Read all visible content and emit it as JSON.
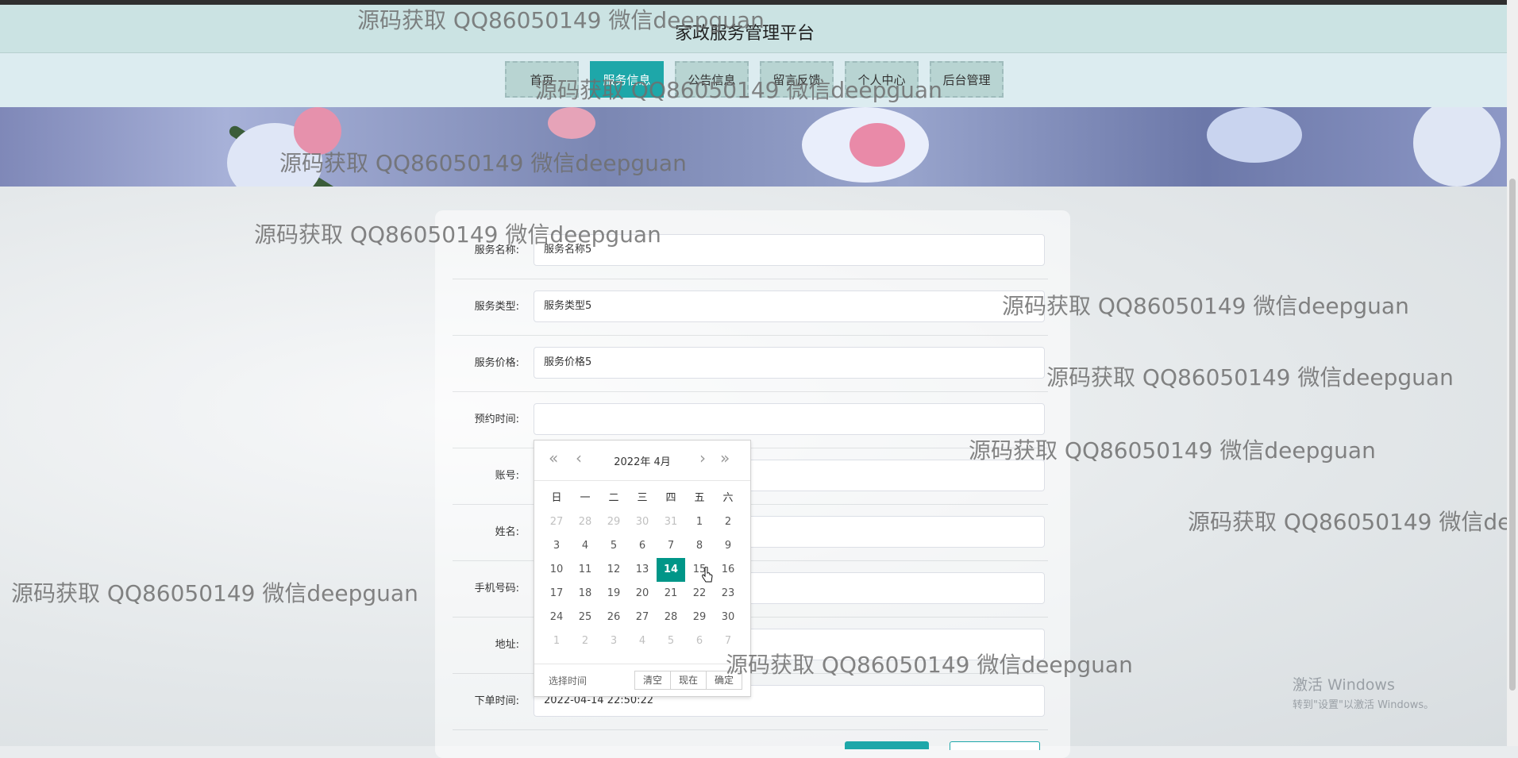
{
  "header": {
    "title": "家政服务管理平台"
  },
  "nav": {
    "items": [
      "首页",
      "服务信息",
      "公告信息",
      "留言反馈",
      "个人中心",
      "后台管理"
    ],
    "active": "服务信息"
  },
  "form": {
    "rows": [
      {
        "label": "服务名称:",
        "value": "服务名称5"
      },
      {
        "label": "服务类型:",
        "value": "服务类型5"
      },
      {
        "label": "服务价格:",
        "value": "服务价格5"
      },
      {
        "label": "预约时间:",
        "value": ""
      },
      {
        "label": "账号:",
        "value": ""
      },
      {
        "label": "姓名:",
        "value": ""
      },
      {
        "label": "手机号码:",
        "value": ""
      },
      {
        "label": "地址:",
        "value": ""
      },
      {
        "label": "下单时间:",
        "value": "2022-04-14 22:50:22"
      }
    ]
  },
  "datepicker": {
    "year_month": "2022年  4月",
    "weekdays": [
      "日",
      "一",
      "二",
      "三",
      "四",
      "五",
      "六"
    ],
    "weeks": [
      [
        "27",
        "28",
        "29",
        "30",
        "31",
        "1",
        "2"
      ],
      [
        "3",
        "4",
        "5",
        "6",
        "7",
        "8",
        "9"
      ],
      [
        "10",
        "11",
        "12",
        "13",
        "14",
        "15",
        "16"
      ],
      [
        "17",
        "18",
        "19",
        "20",
        "21",
        "22",
        "23"
      ],
      [
        "24",
        "25",
        "26",
        "27",
        "28",
        "29",
        "30"
      ],
      [
        "1",
        "2",
        "3",
        "4",
        "5",
        "6",
        "7"
      ]
    ],
    "selected": "14",
    "footer_label": "选择时间",
    "actions": [
      "清空",
      "现在",
      "确定"
    ]
  },
  "watermark": {
    "text": "源码获取 QQ86050149 微信deepguan"
  },
  "windows_activation": {
    "line1": "激活 Windows",
    "line2": "转到\"设置\"以激活 Windows。"
  },
  "colors": {
    "accent": "#1ea7a9",
    "selected_day": "#009688"
  }
}
